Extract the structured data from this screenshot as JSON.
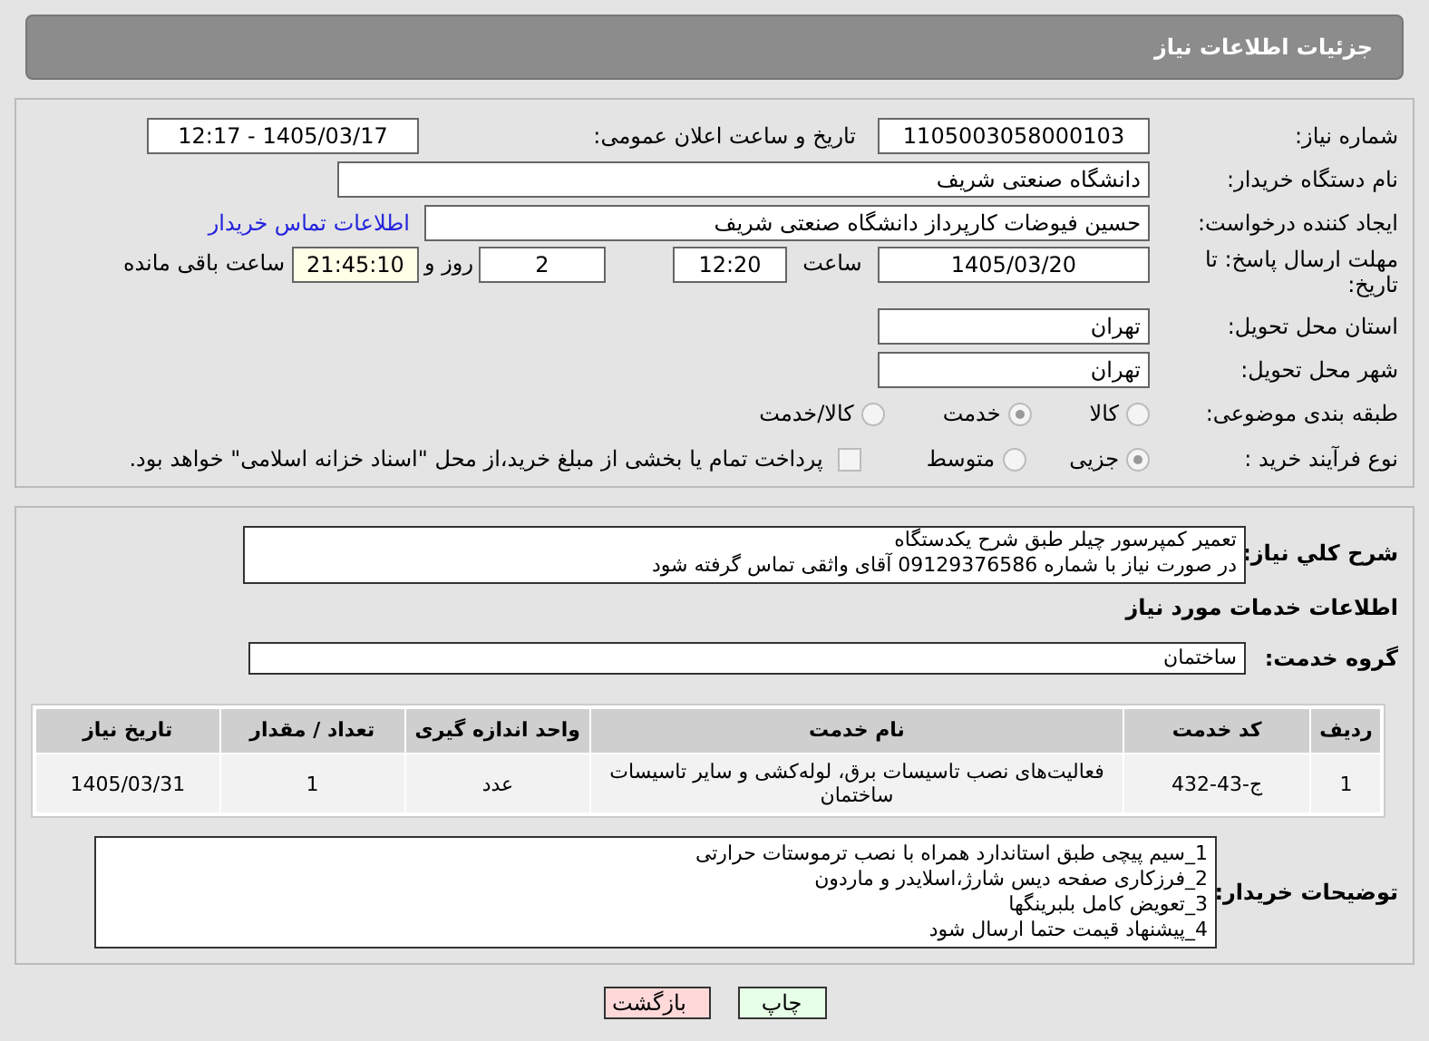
{
  "header": {
    "title": "جزئیات اطلاعات نیاز"
  },
  "details": {
    "need_number": {
      "label": "شماره نیاز:",
      "value": "1105003058000103"
    },
    "announce": {
      "label": "تاریخ و ساعت اعلان عمومی:",
      "value": "1405/03/17 - 12:17"
    },
    "buyer": {
      "label": "نام دستگاه خریدار:",
      "value": "دانشگاه صنعتی شریف"
    },
    "creator": {
      "label": "ایجاد کننده درخواست:",
      "value": "حسین فیوضات کارپرداز دانشگاه صنعتی شریف",
      "link": "اطلاعات تماس خریدار"
    },
    "deadline": {
      "label": "مهلت ارسال پاسخ: تا تاریخ:",
      "date": "1405/03/20",
      "time_label": "ساعت",
      "time": "12:20",
      "days": "2",
      "days_label": "روز و",
      "remaining": "21:45:10",
      "remaining_label": "ساعت باقی مانده"
    },
    "province": {
      "label": "استان محل تحویل:",
      "value": "تهران"
    },
    "city": {
      "label": "شهر محل تحویل:",
      "value": "تهران"
    },
    "category": {
      "label": "طبقه بندی موضوعی:",
      "options": [
        {
          "label": "کالا",
          "selected": false
        },
        {
          "label": "خدمت",
          "selected": true
        },
        {
          "label": "کالا/خدمت",
          "selected": false
        }
      ]
    },
    "process": {
      "label": "نوع فرآیند خرید :",
      "options": [
        {
          "label": "جزیی",
          "selected": true
        },
        {
          "label": "متوسط",
          "selected": false
        }
      ],
      "payment": {
        "label": "پرداخت تمام یا بخشی از مبلغ خرید،از محل \"اسناد خزانه اسلامی\" خواهد بود.",
        "checked": false
      }
    }
  },
  "services": {
    "description": {
      "label": "شرح کلي نياز:",
      "lines": [
        "تعمیر کمپرسور چیلر طبق شرح یکدستگاه",
        "در صورت نیاز با شماره 09129376586 آقای واثقی تماس گرفته شود"
      ]
    },
    "heading": "اطلاعات خدمات مورد نیاز",
    "group": {
      "label": "گروه خدمت:",
      "value": "ساختمان"
    },
    "table": {
      "columns": [
        "ردیف",
        "کد خدمت",
        "نام خدمت",
        "واحد اندازه گیری",
        "تعداد / مقدار",
        "تاریخ نیاز"
      ],
      "rows": [
        [
          "1",
          "ج-43-432",
          "فعالیت‌های نصب تاسیسات برق، لوله‌کشی و سایر تاسیسات ساختمان",
          "عدد",
          "1",
          "1405/03/31"
        ]
      ]
    },
    "notes": {
      "label": "توضیحات خریدار:",
      "lines": [
        "1_سیم پیچی طبق استاندارد همراه با نصب ترموستات حرارتی",
        "2_فرزکاری صفحه دیس شارژ،اسلایدر و ماردون",
        "3_تعویض کامل بلبرینگها",
        "4_پیشنهاد قیمت حتما ارسال شود"
      ]
    }
  },
  "buttons": [
    {
      "label": "چاپ",
      "kind": "print"
    },
    {
      "label": "بازگشت",
      "kind": "back"
    }
  ]
}
